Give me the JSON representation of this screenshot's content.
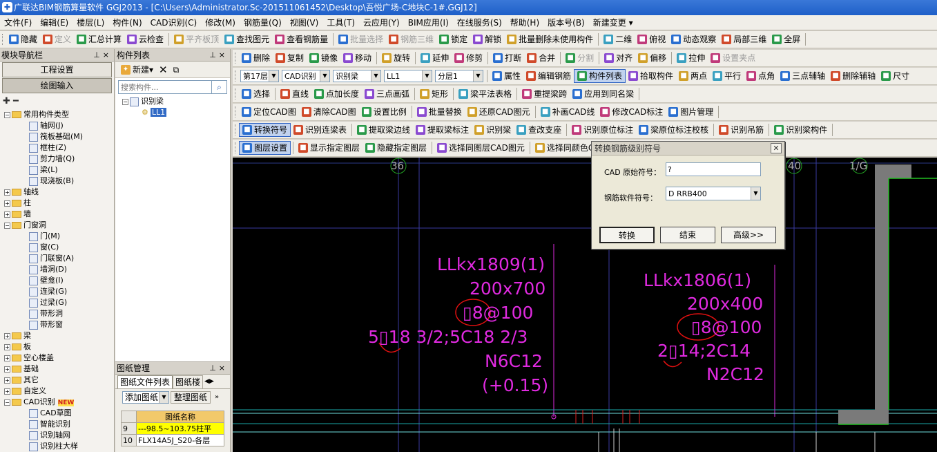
{
  "window": {
    "title": "广联达BIM钢筋算量软件 GGJ2013 - [C:\\Users\\Administrator.Sc-201511061452\\Desktop\\吾悦广场-C地块C-1#.GGJ12]"
  },
  "menu": [
    "文件(F)",
    "编辑(E)",
    "楼层(L)",
    "构件(N)",
    "CAD识别(C)",
    "修改(M)",
    "钢筋量(Q)",
    "视图(V)",
    "工具(T)",
    "云应用(Y)",
    "BIM应用(I)",
    "在线服务(S)",
    "帮助(H)",
    "版本号(B)",
    "新建变更 ▾"
  ],
  "toolbar1": [
    "隐藏",
    "定义",
    "汇总计算",
    "云检查",
    "平齐板顶",
    "查找图元",
    "查看钢筋量",
    "批量选择",
    "钢筋三维",
    "锁定",
    "解锁",
    "批量删除未使用构件",
    "二维",
    "俯视",
    "动态观察",
    "局部三维",
    "全屏"
  ],
  "toolbar2": [
    "删除",
    "复制",
    "镜像",
    "移动",
    "旋转",
    "延伸",
    "修剪",
    "打断",
    "合并",
    "分割",
    "对齐",
    "偏移",
    "拉伸",
    "设置夹点"
  ],
  "toolbar3": {
    "floor": "第17层",
    "cad": "CAD识别",
    "type": "识别梁",
    "component": "LL1",
    "layer": "分层1",
    "buttons": [
      "属性",
      "编辑钢筋",
      "构件列表",
      "拾取构件",
      "两点",
      "平行",
      "点角",
      "三点辅轴",
      "删除辅轴",
      "尺寸"
    ]
  },
  "toolbar4": [
    "选择",
    "直线",
    "点加长度",
    "三点画弧",
    "矩形",
    "梁平法表格",
    "重提梁跨",
    "应用到同名梁"
  ],
  "toolbar5": [
    "定位CAD图",
    "清除CAD图",
    "设置比例",
    "批量替换",
    "还原CAD图元",
    "补画CAD线",
    "修改CAD标注",
    "图片管理"
  ],
  "toolbar6": [
    "转换符号",
    "识别连梁表",
    "提取梁边线",
    "提取梁标注",
    "识别梁",
    "查改支座",
    "识别原位标注",
    "梁原位标注校核",
    "识别吊筋",
    "识别梁构件"
  ],
  "toolbar7": [
    "图层设置",
    "显示指定图层",
    "隐藏指定图层",
    "选择同图层CAD图元",
    "选择同颜色CAD"
  ],
  "nav": {
    "title": "模块导航栏",
    "tabs": [
      "工程设置",
      "绘图输入"
    ],
    "tree": [
      {
        "label": "常用构件类型",
        "level": 0,
        "kind": "folder-open"
      },
      {
        "label": "轴网(J)",
        "level": 1,
        "kind": "leaf"
      },
      {
        "label": "筏板基础(M)",
        "level": 1,
        "kind": "leaf"
      },
      {
        "label": "框柱(Z)",
        "level": 1,
        "kind": "leaf"
      },
      {
        "label": "剪力墙(Q)",
        "level": 1,
        "kind": "leaf"
      },
      {
        "label": "梁(L)",
        "level": 1,
        "kind": "leaf"
      },
      {
        "label": "现浇板(B)",
        "level": 1,
        "kind": "leaf"
      },
      {
        "label": "轴线",
        "level": 0,
        "kind": "folder"
      },
      {
        "label": "柱",
        "level": 0,
        "kind": "folder"
      },
      {
        "label": "墙",
        "level": 0,
        "kind": "folder"
      },
      {
        "label": "门窗洞",
        "level": 0,
        "kind": "folder-open"
      },
      {
        "label": "门(M)",
        "level": 1,
        "kind": "leaf"
      },
      {
        "label": "窗(C)",
        "level": 1,
        "kind": "leaf"
      },
      {
        "label": "门联窗(A)",
        "level": 1,
        "kind": "leaf"
      },
      {
        "label": "墙洞(D)",
        "level": 1,
        "kind": "leaf"
      },
      {
        "label": "壁龛(I)",
        "level": 1,
        "kind": "leaf"
      },
      {
        "label": "连梁(G)",
        "level": 1,
        "kind": "leaf"
      },
      {
        "label": "过梁(G)",
        "level": 1,
        "kind": "leaf"
      },
      {
        "label": "带形洞",
        "level": 1,
        "kind": "leaf"
      },
      {
        "label": "带形窗",
        "level": 1,
        "kind": "leaf"
      },
      {
        "label": "梁",
        "level": 0,
        "kind": "folder"
      },
      {
        "label": "板",
        "level": 0,
        "kind": "folder"
      },
      {
        "label": "空心楼盖",
        "level": 0,
        "kind": "folder"
      },
      {
        "label": "基础",
        "level": 0,
        "kind": "folder"
      },
      {
        "label": "其它",
        "level": 0,
        "kind": "folder"
      },
      {
        "label": "自定义",
        "level": 0,
        "kind": "folder"
      },
      {
        "label": "CAD识别",
        "level": 0,
        "kind": "folder-open",
        "badge": "NEW"
      },
      {
        "label": "CAD草图",
        "level": 1,
        "kind": "leaf"
      },
      {
        "label": "智能识别",
        "level": 1,
        "kind": "leaf"
      },
      {
        "label": "识别轴网",
        "level": 1,
        "kind": "leaf"
      },
      {
        "label": "识别柱大样",
        "level": 1,
        "kind": "leaf"
      }
    ]
  },
  "component_list": {
    "title": "构件列表",
    "new_label": "新建",
    "search_placeholder": "搜索构件...",
    "tree": [
      {
        "label": "识别梁",
        "level": 0
      },
      {
        "label": "LL1",
        "level": 1,
        "selected": true
      }
    ]
  },
  "drawing_mgmt": {
    "title": "图纸管理",
    "tabs": [
      "图纸文件列表",
      "图纸楼"
    ],
    "add_label": "添加图纸",
    "organize_label": "整理图纸",
    "column": "图纸名称",
    "rows": [
      {
        "num": "9",
        "name": "---98.5~103.75柱平",
        "highlight": true
      },
      {
        "num": "10",
        "name": "FLX14A5J_S20-各层"
      }
    ]
  },
  "canvas": {
    "axis_labels": [
      "36",
      "40",
      "1/G"
    ],
    "beam_left": [
      "LLkx1809(1)",
      "200x700",
      "▯8@100",
      "5▯18 3/2;5C18 2/3",
      "N6C12",
      "(+0.15)"
    ],
    "beam_right": [
      "LLkx1806(1)",
      "200x400",
      "▯8@100",
      "2▯14;2C14",
      "N2C12"
    ]
  },
  "dialog": {
    "title": "转换钢筋级别符号",
    "cad_label": "CAD 原始符号：",
    "cad_value": "?",
    "soft_label": "钢筋软件符号：",
    "soft_value": "D RRB400",
    "btn_convert": "转换",
    "btn_end": "结束",
    "btn_advanced": "高级>>"
  }
}
